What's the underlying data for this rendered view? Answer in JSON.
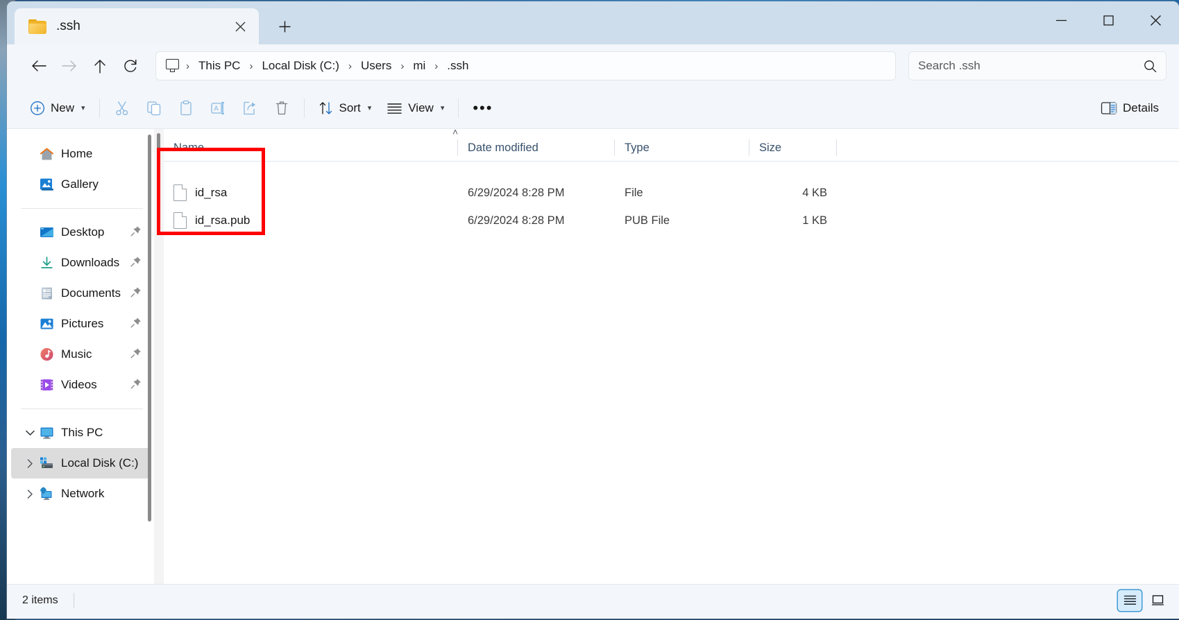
{
  "window": {
    "tab_title": ".ssh",
    "folder_icon": "folder-icon",
    "close_tab_icon": "close-icon",
    "new_tab_icon": "plus-icon",
    "minimize_icon": "minimize-icon",
    "maximize_icon": "maximize-icon",
    "close_icon": "close-icon"
  },
  "nav": {
    "back_icon": "arrow-left-icon",
    "forward_icon": "arrow-right-icon",
    "up_icon": "arrow-up-icon",
    "refresh_icon": "refresh-icon",
    "breadcrumb": [
      {
        "label": "This PC"
      },
      {
        "label": "Local Disk (C:)"
      },
      {
        "label": "Users"
      },
      {
        "label": "mi"
      },
      {
        "label": ".ssh"
      }
    ],
    "separator": "›"
  },
  "search": {
    "placeholder": "Search .ssh",
    "value": "",
    "icon": "search-icon"
  },
  "toolbar": {
    "new_label": "New",
    "cut_icon": "scissors-icon",
    "copy_icon": "copy-icon",
    "paste_icon": "clipboard-icon",
    "rename_icon": "rename-icon",
    "share_icon": "share-icon",
    "delete_icon": "trash-icon",
    "sort_label": "Sort",
    "view_label": "View",
    "overflow_label": "•••",
    "details_label": "Details"
  },
  "sidebar": {
    "items": [
      {
        "label": "Home",
        "icon": "home-icon",
        "pinned": false,
        "twisty": "",
        "selected": false
      },
      {
        "label": "Gallery",
        "icon": "gallery-icon",
        "pinned": false,
        "twisty": "",
        "selected": false
      },
      {
        "label": "Desktop",
        "icon": "desktop-icon",
        "pinned": true,
        "twisty": "",
        "selected": false
      },
      {
        "label": "Downloads",
        "icon": "download-icon",
        "pinned": true,
        "twisty": "",
        "selected": false
      },
      {
        "label": "Documents",
        "icon": "document-icon",
        "pinned": true,
        "twisty": "",
        "selected": false
      },
      {
        "label": "Pictures",
        "icon": "pictures-icon",
        "pinned": true,
        "twisty": "",
        "selected": false
      },
      {
        "label": "Music",
        "icon": "music-icon",
        "pinned": true,
        "twisty": "",
        "selected": false
      },
      {
        "label": "Videos",
        "icon": "videos-icon",
        "pinned": true,
        "twisty": "",
        "selected": false
      },
      {
        "label": "This PC",
        "icon": "thispc-icon",
        "pinned": false,
        "twisty": "⌄",
        "selected": false
      },
      {
        "label": "Local Disk (C:)",
        "icon": "drive-icon",
        "pinned": true,
        "twisty": "›",
        "selected": true
      },
      {
        "label": "Network",
        "icon": "network-icon",
        "pinned": false,
        "twisty": "›",
        "selected": false
      }
    ]
  },
  "filelist": {
    "columns": [
      "Name",
      "Date modified",
      "Type",
      "Size"
    ],
    "sort_indicator": "˄",
    "rows": [
      {
        "name": "id_rsa",
        "date": "6/29/2024 8:28 PM",
        "type": "File",
        "size": "4 KB",
        "icon": "file-icon"
      },
      {
        "name": "id_rsa.pub",
        "date": "6/29/2024 8:28 PM",
        "type": "PUB File",
        "size": "1 KB",
        "icon": "file-icon"
      }
    ]
  },
  "annotation": {
    "color": "#fe0000",
    "shape": "rectangle"
  },
  "statusbar": {
    "item_count": "2 items",
    "details_view_icon": "list-view-icon",
    "large_icons_view_icon": "tile-view-icon"
  }
}
